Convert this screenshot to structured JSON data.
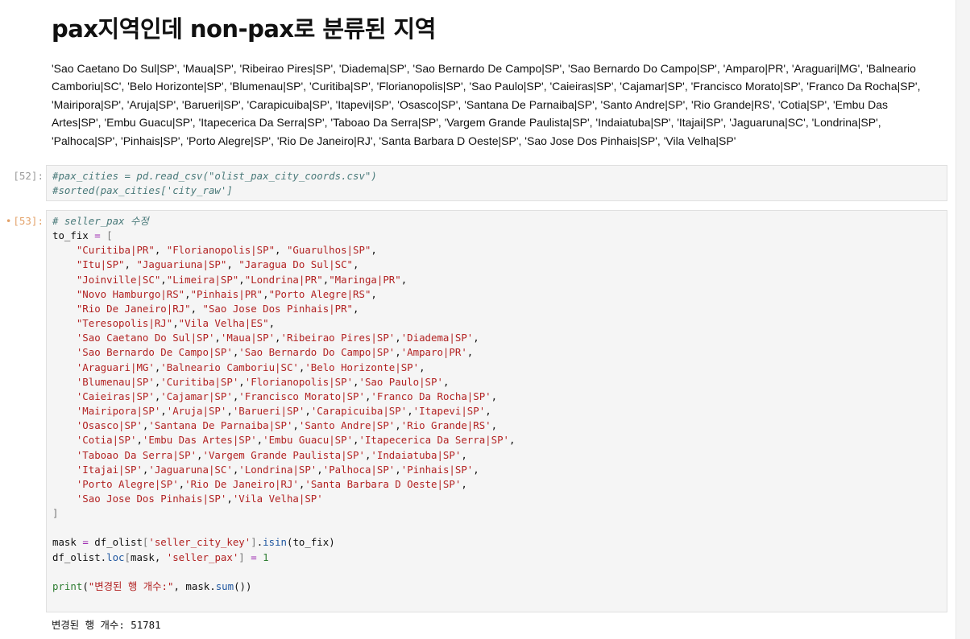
{
  "markdown": {
    "heading": "pax지역인데 non-pax로 분류된 지역",
    "paragraph": "'Sao Caetano Do Sul|SP', 'Maua|SP', 'Ribeirao Pires|SP', 'Diadema|SP', 'Sao Bernardo De Campo|SP', 'Sao Bernardo Do Campo|SP', 'Amparo|PR', 'Araguari|MG', 'Balneario Camboriu|SC', 'Belo Horizonte|SP', 'Blumenau|SP', 'Curitiba|SP', 'Florianopolis|SP', 'Sao Paulo|SP', 'Caieiras|SP', 'Cajamar|SP', 'Francisco Morato|SP', 'Franco Da Rocha|SP', 'Mairipora|SP', 'Aruja|SP', 'Barueri|SP', 'Carapicuiba|SP', 'Itapevi|SP', 'Osasco|SP', 'Santana De Parnaiba|SP', 'Santo Andre|SP', 'Rio Grande|RS', 'Cotia|SP', 'Embu Das Artes|SP', 'Embu Guacu|SP', 'Itapecerica Da Serra|SP', 'Taboao Da Serra|SP', 'Vargem Grande Paulista|SP', 'Indaiatuba|SP', 'Itajai|SP', 'Jaguaruna|SC', 'Londrina|SP', 'Palhoca|SP', 'Pinhais|SP', 'Porto Alegre|SP', 'Rio De Janeiro|RJ', 'Santa Barbara D Oeste|SP', 'Sao Jose Dos Pinhais|SP', 'Vila Velha|SP'"
  },
  "cells": [
    {
      "prompt": "[52]:",
      "lines": [
        "#pax_cities = pd.read_csv(\"olist_pax_city_coords.csv\")",
        "#sorted(pax_cities['city_raw']"
      ]
    },
    {
      "prompt": "[53]:",
      "running_dot": "•",
      "header_comment": "# seller_pax 수정",
      "var_name": "to_fix",
      "assign": "=",
      "open_bracket": "[",
      "close_bracket": "]",
      "list_lines": [
        [
          "\"Curitiba|PR\"",
          "\"Florianopolis|SP\"",
          "\"Guarulhos|SP\""
        ],
        [
          "\"Itu|SP\"",
          "\"Jaguariuna|SP\"",
          "\"Jaragua Do Sul|SC\""
        ],
        [
          "\"Joinville|SC\"",
          "\"Limeira|SP\"",
          "\"Londrina|PR\"",
          "\"Maringa|PR\""
        ],
        [
          "\"Novo Hamburgo|RS\"",
          "\"Pinhais|PR\"",
          "\"Porto Alegre|RS\""
        ],
        [
          "\"Rio De Janeiro|RJ\"",
          "\"Sao Jose Dos Pinhais|PR\""
        ],
        [
          "\"Teresopolis|RJ\"",
          "\"Vila Velha|ES\""
        ],
        [
          "'Sao Caetano Do Sul|SP'",
          "'Maua|SP'",
          "'Ribeirao Pires|SP'",
          "'Diadema|SP'"
        ],
        [
          "'Sao Bernardo De Campo|SP'",
          "'Sao Bernardo Do Campo|SP'",
          "'Amparo|PR'"
        ],
        [
          "'Araguari|MG'",
          "'Balneario Camboriu|SC'",
          "'Belo Horizonte|SP'"
        ],
        [
          "'Blumenau|SP'",
          "'Curitiba|SP'",
          "'Florianopolis|SP'",
          "'Sao Paulo|SP'"
        ],
        [
          "'Caieiras|SP'",
          "'Cajamar|SP'",
          "'Francisco Morato|SP'",
          "'Franco Da Rocha|SP'"
        ],
        [
          "'Mairipora|SP'",
          "'Aruja|SP'",
          "'Barueri|SP'",
          "'Carapicuiba|SP'",
          "'Itapevi|SP'"
        ],
        [
          "'Osasco|SP'",
          "'Santana De Parnaiba|SP'",
          "'Santo Andre|SP'",
          "'Rio Grande|RS'"
        ],
        [
          "'Cotia|SP'",
          "'Embu Das Artes|SP'",
          "'Embu Guacu|SP'",
          "'Itapecerica Da Serra|SP'"
        ],
        [
          "'Taboao Da Serra|SP'",
          "'Vargem Grande Paulista|SP'",
          "'Indaiatuba|SP'"
        ],
        [
          "'Itajai|SP'",
          "'Jaguaruna|SC'",
          "'Londrina|SP'",
          "'Palhoca|SP'",
          "'Pinhais|SP'"
        ],
        [
          "'Porto Alegre|SP'",
          "'Rio De Janeiro|RJ'",
          "'Santa Barbara D Oeste|SP'"
        ],
        [
          "'Sao Jose Dos Pinhais|SP'",
          "'Vila Velha|SP'"
        ]
      ],
      "line_separators": [
        ",",
        ",",
        ",",
        ",",
        ",",
        ",",
        ",",
        ",",
        ",",
        ",",
        ",",
        ",",
        ",",
        ",",
        ",",
        ",",
        ",",
        ""
      ],
      "mask_line": {
        "var": "mask",
        "eq": "=",
        "obj": "df_olist",
        "key": "'seller_city_key'",
        "method": "isin",
        "arg": "to_fix"
      },
      "loc_line": {
        "obj": "df_olist",
        "method": "loc",
        "arg1": "mask",
        "key": "'seller_pax'",
        "eq": "=",
        "value": "1"
      },
      "print_line": {
        "fn": "print",
        "label": "\"변경된 행 개수:\"",
        "arg": "mask",
        "method": "sum"
      },
      "output": "변경된 행 개수: 51781"
    }
  ]
}
